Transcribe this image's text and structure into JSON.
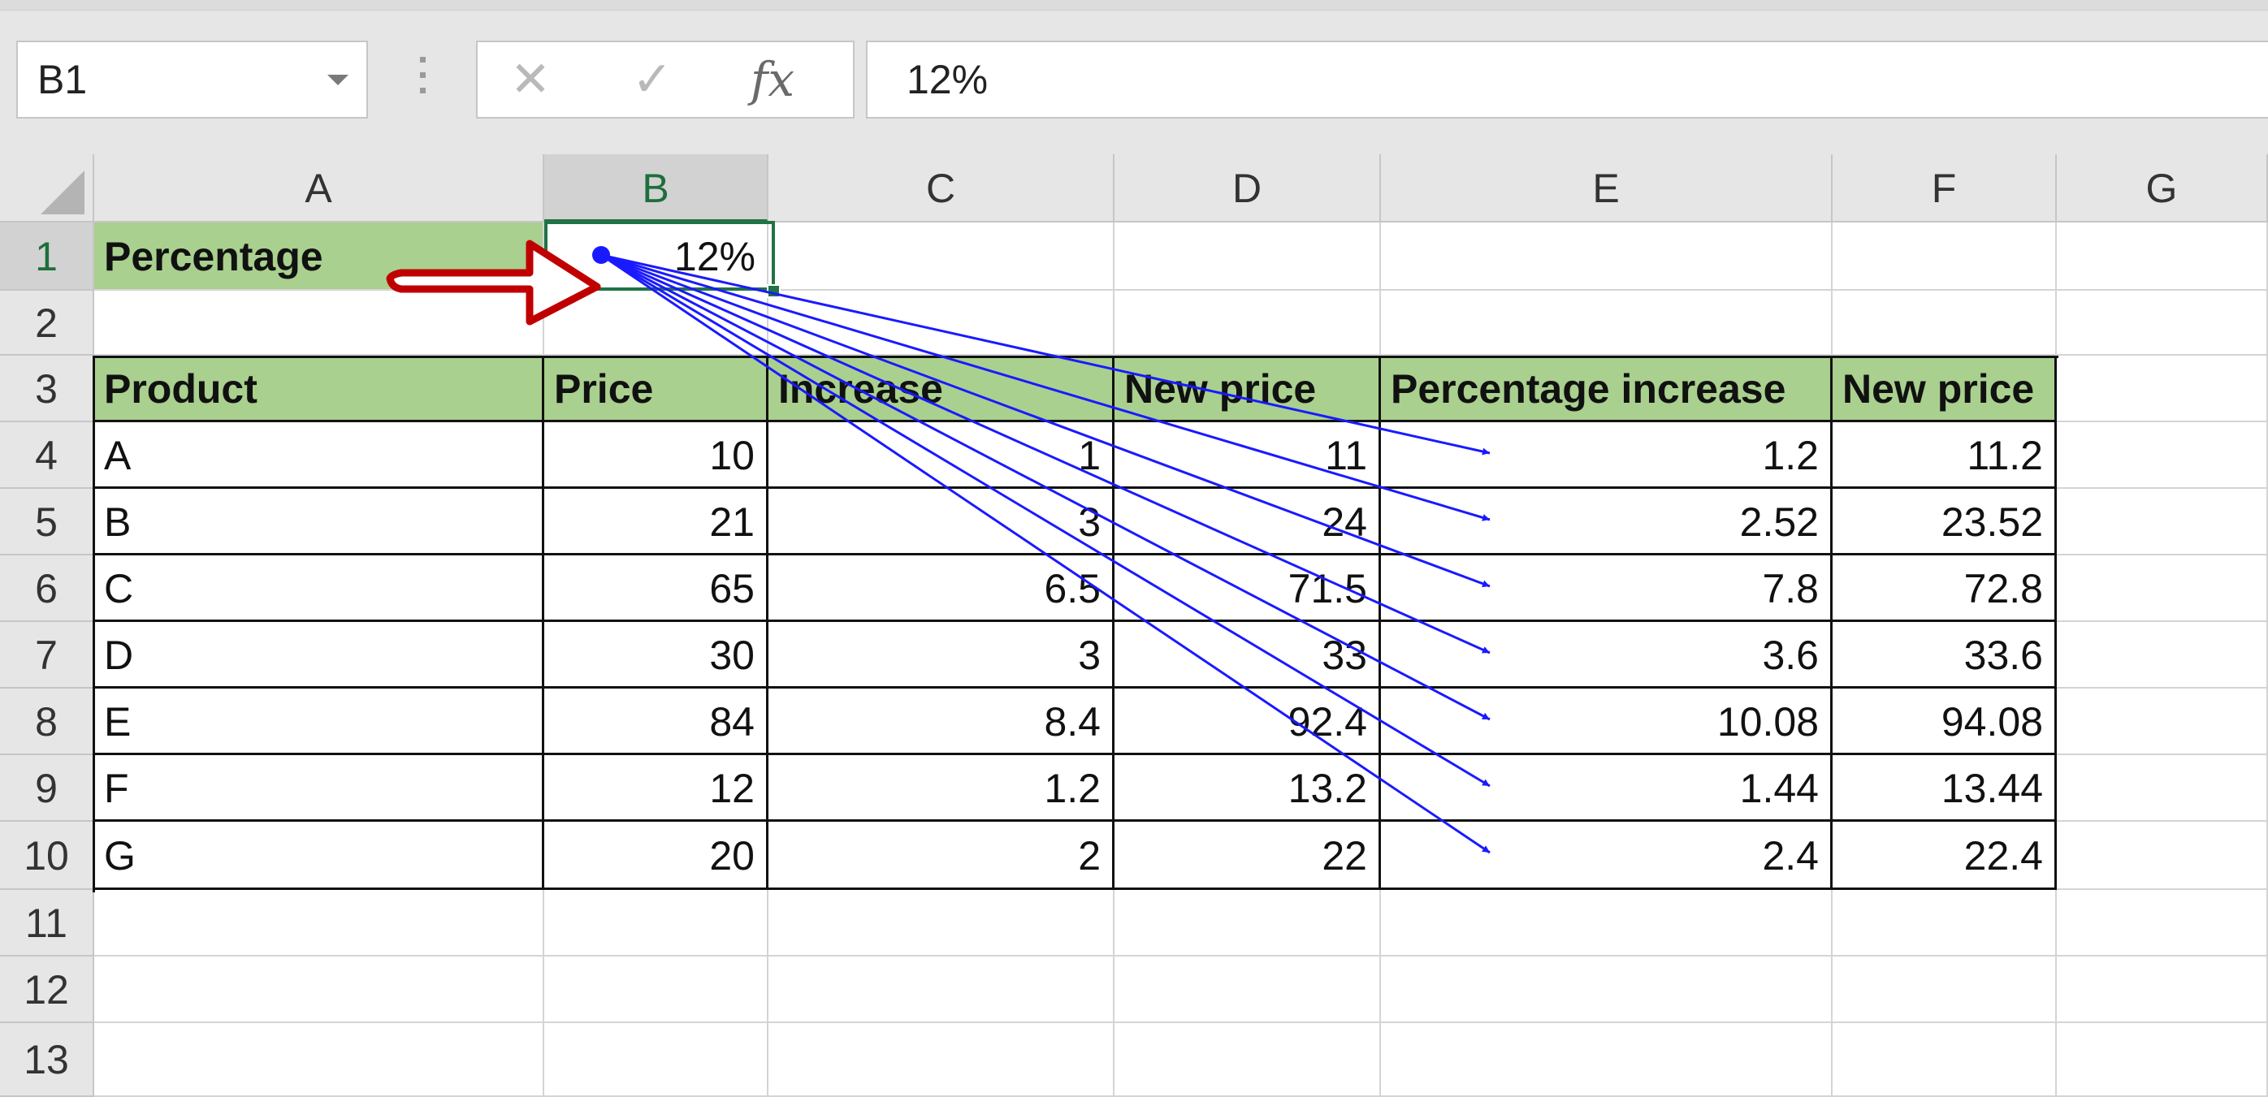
{
  "formula_bar": {
    "name_box": "B1",
    "cancel_glyph": "✕",
    "enter_glyph": "✓",
    "fx_label": "fx",
    "formula_value": "12%"
  },
  "grid": {
    "columns": [
      "A",
      "B",
      "C",
      "D",
      "E",
      "F",
      "G"
    ],
    "rows": [
      "1",
      "2",
      "3",
      "4",
      "5",
      "6",
      "7",
      "8",
      "9",
      "10",
      "11",
      "12",
      "13"
    ],
    "selected_cell": "B1",
    "selected_column": "B",
    "selected_row": "1"
  },
  "sheet": {
    "A1": "Percentage",
    "B1": "12%",
    "headers": [
      "Product",
      "Price",
      "Increase",
      "New price",
      "Percentage increase",
      "New price"
    ],
    "rows": [
      [
        "A",
        "10",
        "1",
        "11",
        "1.2",
        "11.2"
      ],
      [
        "B",
        "21",
        "3",
        "24",
        "2.52",
        "23.52"
      ],
      [
        "C",
        "65",
        "6.5",
        "71.5",
        "7.8",
        "72.8"
      ],
      [
        "D",
        "30",
        "3",
        "33",
        "3.6",
        "33.6"
      ],
      [
        "E",
        "84",
        "8.4",
        "92.4",
        "10.08",
        "94.08"
      ],
      [
        "F",
        "12",
        "1.2",
        "13.2",
        "1.44",
        "13.44"
      ],
      [
        "G",
        "20",
        "2",
        "22",
        "2.4",
        "22.4"
      ]
    ]
  },
  "annotations": {
    "trace_dependents_color": "#1a1aff",
    "highlight_arrow_color": "#c00000",
    "header_fill_color": "#a9d08e",
    "dependent_targets": [
      "E4",
      "E5",
      "E6",
      "E7",
      "E8",
      "E9",
      "E10"
    ]
  }
}
